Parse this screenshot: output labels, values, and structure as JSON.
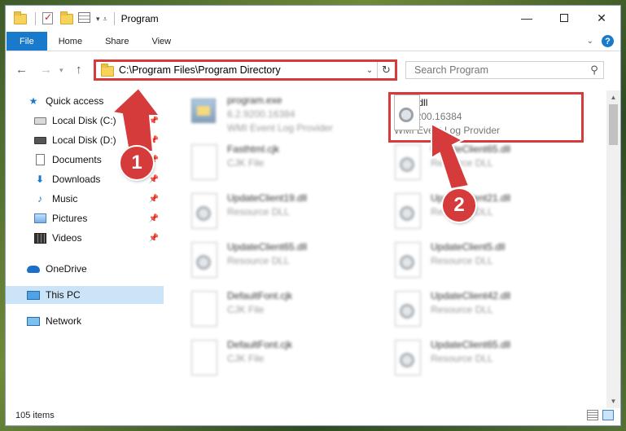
{
  "window": {
    "title": "Program",
    "controls": {
      "minimize": "—",
      "close": "✕"
    }
  },
  "ribbon": {
    "tabs": [
      "File",
      "Home",
      "Share",
      "View"
    ],
    "help": "?"
  },
  "address": {
    "path": "C:\\Program Files\\Program Directory",
    "search_placeholder": "Search Program"
  },
  "sidebar": {
    "items": [
      {
        "label": "Quick access",
        "icon": "star-icon"
      },
      {
        "label": "Local Disk (C:)",
        "icon": "drive-icon",
        "pinned": true
      },
      {
        "label": "Local Disk (D:)",
        "icon": "drive-icon",
        "pinned": true
      },
      {
        "label": "Documents",
        "icon": "documents-icon",
        "pinned": true
      },
      {
        "label": "Downloads",
        "icon": "downloads-icon",
        "pinned": true
      },
      {
        "label": "Music",
        "icon": "music-icon",
        "pinned": true
      },
      {
        "label": "Pictures",
        "icon": "pictures-icon",
        "pinned": true
      },
      {
        "label": "Videos",
        "icon": "videos-icon",
        "pinned": true
      },
      {
        "label": "OneDrive",
        "icon": "onedrive-icon"
      },
      {
        "label": "This PC",
        "icon": "computer-icon",
        "selected": true
      },
      {
        "label": "Network",
        "icon": "network-icon"
      }
    ]
  },
  "files": {
    "highlighted": {
      "name": "ntevt.dll",
      "version": "6.2.9200.16384",
      "desc": "WMI Event Log Provider"
    },
    "items": [
      {
        "name": "program.exe",
        "sub1": "6.2.9200.16384",
        "sub2": "WMI Event Log Provider",
        "kind": "exe"
      },
      {
        "name": "Fasthtml.cjk",
        "sub1": "CJK File",
        "kind": "doc"
      },
      {
        "name": "UpdateClient65.dll",
        "sub1": "Resource DLL",
        "kind": "dll"
      },
      {
        "name": "UpdateClient19.dll",
        "sub1": "Resource DLL",
        "kind": "dll"
      },
      {
        "name": "UpdateClient21.dll",
        "sub1": "Resource DLL",
        "kind": "dll"
      },
      {
        "name": "UpdateClient65.dll",
        "sub1": "Resource DLL",
        "kind": "dll"
      },
      {
        "name": "UpdateClient5.dll",
        "sub1": "Resource DLL",
        "kind": "dll"
      },
      {
        "name": "DefaultFont.cjk",
        "sub1": "CJK File",
        "kind": "doc"
      },
      {
        "name": "UpdateClient42.dll",
        "sub1": "Resource DLL",
        "kind": "dll"
      },
      {
        "name": "DefaultFont.cjk",
        "sub1": "CJK File",
        "kind": "doc"
      },
      {
        "name": "UpdateClient65.dll",
        "sub1": "Resource DLL",
        "kind": "dll"
      }
    ]
  },
  "status": {
    "count": "105 items"
  },
  "callouts": {
    "one": "1",
    "two": "2"
  },
  "colors": {
    "accent": "#1979ca",
    "highlight": "#d63b3b",
    "selected": "#cce4f7"
  }
}
